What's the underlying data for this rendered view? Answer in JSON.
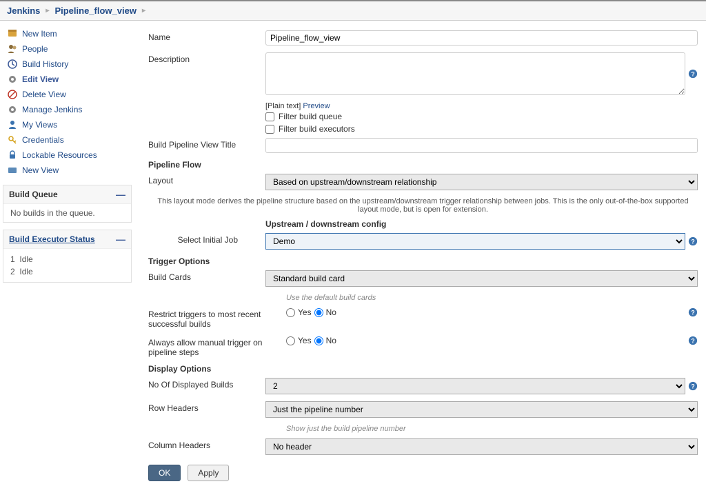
{
  "breadcrumb": {
    "root": "Jenkins",
    "view": "Pipeline_flow_view"
  },
  "sidebar": {
    "items": [
      {
        "label": "New Item",
        "bold": false
      },
      {
        "label": "People",
        "bold": false
      },
      {
        "label": "Build History",
        "bold": false
      },
      {
        "label": "Edit View",
        "bold": true
      },
      {
        "label": "Delete View",
        "bold": false
      },
      {
        "label": "Manage Jenkins",
        "bold": false
      },
      {
        "label": "My Views",
        "bold": false
      },
      {
        "label": "Credentials",
        "bold": false
      },
      {
        "label": "Lockable Resources",
        "bold": false
      },
      {
        "label": "New View",
        "bold": false
      }
    ]
  },
  "buildQueue": {
    "title": "Build Queue",
    "empty_text": "No builds in the queue."
  },
  "executors": {
    "title": "Build Executor Status",
    "list": [
      {
        "num": "1",
        "state": "Idle"
      },
      {
        "num": "2",
        "state": "Idle"
      }
    ]
  },
  "form": {
    "name_label": "Name",
    "name_value": "Pipeline_flow_view",
    "desc_label": "Description",
    "desc_value": "",
    "desc_hint_prefix": "[Plain text]",
    "desc_preview": "Preview",
    "filter_queue": "Filter build queue",
    "filter_exec": "Filter build executors",
    "pipeline_title_label": "Build Pipeline View Title",
    "pipeline_title_value": "",
    "section_flow": "Pipeline Flow",
    "layout_label": "Layout",
    "layout_value": "Based on upstream/downstream relationship",
    "layout_help": "This layout mode derives the pipeline structure based on the upstream/downstream trigger relationship between jobs. This is the only out-of-the-box supported layout mode, but is open for extension.",
    "upstream_header": "Upstream / downstream config",
    "initial_job_label": "Select Initial Job",
    "initial_job_value": "Demo",
    "section_trigger": "Trigger Options",
    "build_cards_label": "Build Cards",
    "build_cards_value": "Standard build card",
    "build_cards_help": "Use the default build cards",
    "restrict_label": "Restrict triggers to most recent successful builds",
    "yes": "Yes",
    "no": "No",
    "always_manual_label": "Always allow manual trigger on pipeline steps",
    "section_display": "Display Options",
    "num_builds_label": "No Of Displayed Builds",
    "num_builds_value": "2",
    "row_headers_label": "Row Headers",
    "row_headers_value": "Just the pipeline number",
    "row_headers_help": "Show just the build pipeline number",
    "col_headers_label": "Column Headers",
    "col_headers_value": "No header"
  },
  "buttons": {
    "ok": "OK",
    "apply": "Apply"
  }
}
